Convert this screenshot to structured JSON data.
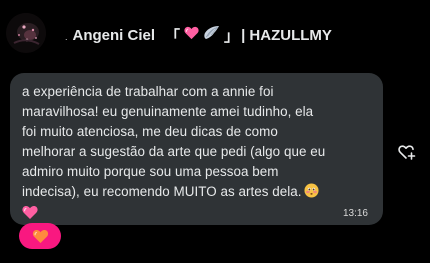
{
  "conversation": {
    "sender": {
      "prefix_symbol": ".",
      "name": "Angeni Ciel",
      "bracket_open": "「",
      "bracket_close": "」",
      "handle_suffix": "| HAZULLMY",
      "decoration_icons": [
        "pink-heart-icon",
        "wing-icon"
      ],
      "avatar": "avatar-image"
    },
    "message": {
      "lines": [
        "a experiência de trabalhar com a annie foi",
        "maravilhosa! eu genuinamente amei tudinho, ela",
        "foi muito atenciosa, me deu dicas de como",
        "melhorar a sugestão da arte que pedi (algo que eu",
        "admiro muito porque sou uma pessoa bem",
        "indecisa), eu recomendo MUITO as artes dela."
      ],
      "emojis": [
        "blushing-face-icon",
        "pink-heart-icon"
      ],
      "timestamp": "13:16"
    },
    "reaction": {
      "icon": "orange-heart-icon",
      "active": true
    },
    "actions": {
      "add_reaction_icon": "heart-plus-icon"
    },
    "colors": {
      "background": "#000000",
      "bubble": "#2f3336",
      "text": "#e7e9ea",
      "reaction_pill": "#f91880",
      "pink_heart": "#ff5fa2",
      "orange_heart": "#ff8a3d"
    }
  }
}
